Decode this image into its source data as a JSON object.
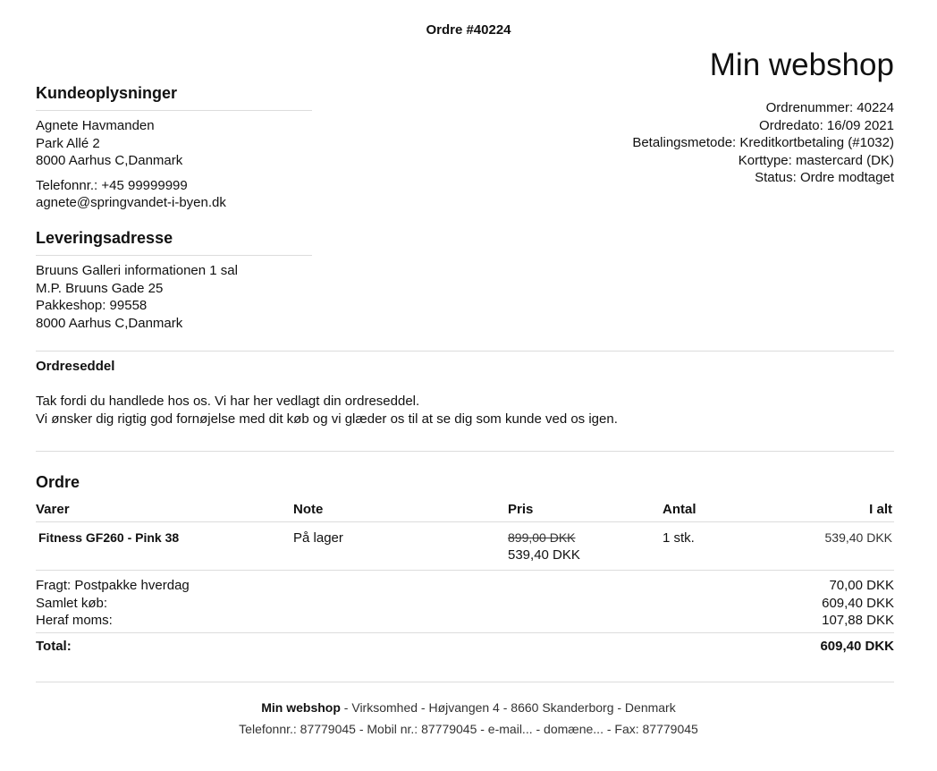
{
  "document": {
    "title": "Ordre #40224",
    "shop_name": "Min webshop"
  },
  "order_meta": {
    "order_number": "Ordrenummer: 40224",
    "order_date": "Ordredato: 16/09 2021",
    "payment_method": "Betalingsmetode: Kreditkortbetaling (#1032)",
    "card_type": "Korttype: mastercard (DK)",
    "status": "Status: Ordre modtaget"
  },
  "customer": {
    "heading": "Kundeoplysninger",
    "name": "Agnete Havmanden",
    "street": "Park Allé 2",
    "city": "8000 Aarhus C,Danmark",
    "phone": "Telefonnr.: +45 99999999",
    "email": "agnete@springvandet-i-byen.dk"
  },
  "delivery": {
    "heading": "Leveringsadresse",
    "line1": "Bruuns Galleri informationen 1 sal",
    "line2": "M.P. Bruuns Gade 25",
    "line3": "Pakkeshop: 99558",
    "line4": "8000 Aarhus C,Danmark"
  },
  "intro": {
    "title": "Ordreseddel",
    "line1": "Tak fordi du handlede hos os. Vi har her vedlagt din ordreseddel.",
    "line2": "Vi ønsker dig rigtig god fornøjelse med dit køb og vi glæder os til at se dig som kunde ved os igen."
  },
  "order": {
    "heading": "Ordre",
    "columns": {
      "items": "Varer",
      "note": "Note",
      "price": "Pris",
      "qty": "Antal",
      "total": "I alt"
    },
    "items": [
      {
        "name": "Fitness GF260 - Pink 38",
        "note": "På lager",
        "old_price": "899,00 DKK",
        "price": "539,40 DKK",
        "qty": "1 stk.",
        "total": "539,40 DKK"
      }
    ],
    "shipping_label": "Fragt: Postpakke hverdag",
    "shipping_value": "70,00 DKK",
    "subtotal_label": "Samlet køb:",
    "subtotal_value": "609,40 DKK",
    "vat_label": "Heraf moms:",
    "vat_value": "107,88 DKK",
    "total_label": "Total:",
    "total_value": "609,40 DKK"
  },
  "footer": {
    "company": "Min webshop",
    "line1_rest": " - Virksomhed - Højvangen 4 - 8660 Skanderborg - Denmark",
    "line2": "Telefonnr.: 87779045 - Mobil nr.: 87779045 - e-mail... - domæne... - Fax: 87779045"
  }
}
